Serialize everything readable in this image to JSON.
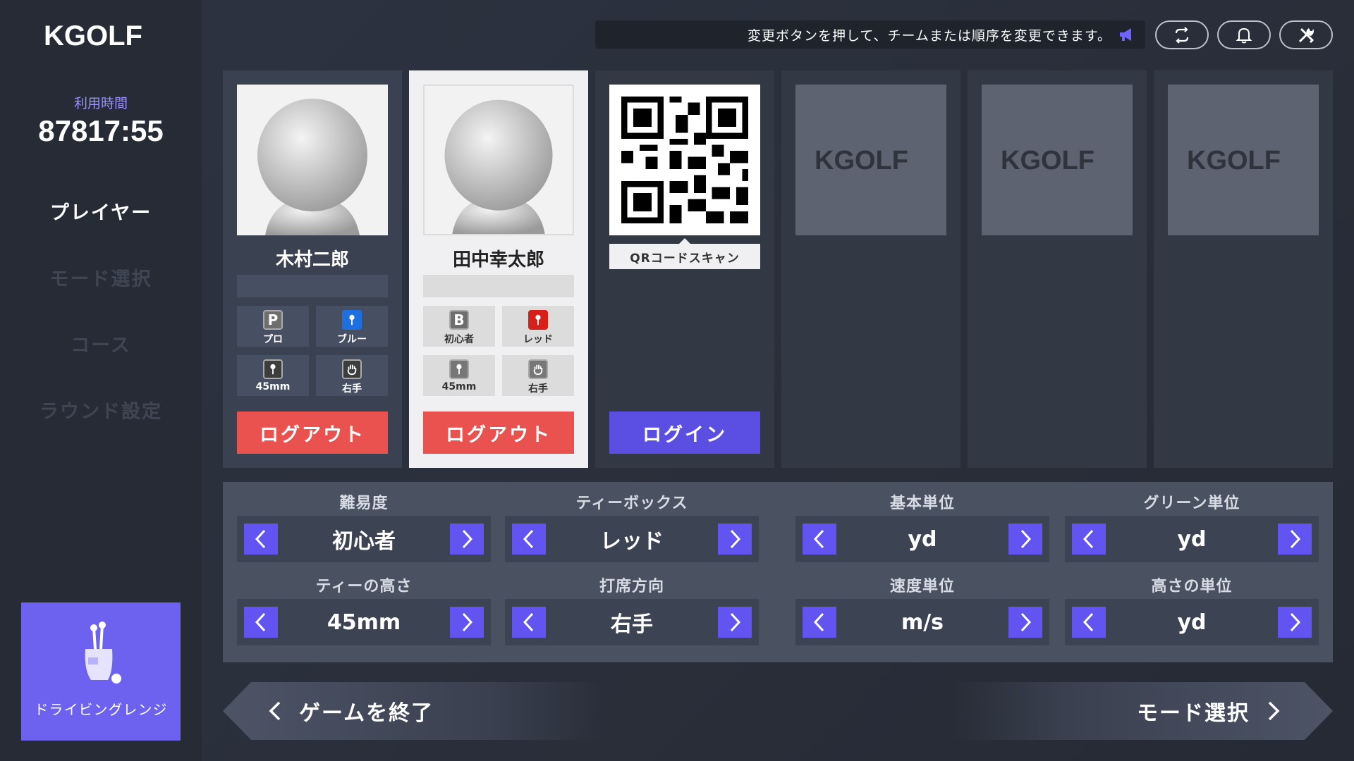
{
  "app": {
    "logo_text": "KGOLF"
  },
  "sidebar": {
    "usage_label": "利用時間",
    "usage_time": "87817:55",
    "nav": [
      {
        "label": "プレイヤー",
        "active": true
      },
      {
        "label": "モード選択",
        "active": false
      },
      {
        "label": "コース",
        "active": false
      },
      {
        "label": "ラウンド設定",
        "active": false
      }
    ],
    "range_label": "ドライビングレンジ"
  },
  "topbar": {
    "notice": "変更ボタンを押して、チームまたは順序を変更できます。",
    "buttons": [
      "swap-icon",
      "bell-icon",
      "tools-icon"
    ]
  },
  "players": [
    {
      "name": "木村二郎",
      "level_badge": "P",
      "level": "プロ",
      "tee_color": "ブルー",
      "tee_height": "45mm",
      "hand": "右手",
      "action": "ログアウト"
    },
    {
      "name": "田中幸太郎",
      "level_badge": "B",
      "level": "初心者",
      "tee_color": "レッド",
      "tee_height": "45mm",
      "hand": "右手",
      "action": "ログアウト"
    }
  ],
  "login_slot": {
    "qr_label": "QRコードスキャン",
    "action": "ログイン"
  },
  "empty_slots": [
    "KGOLF",
    "KGOLF",
    "KGOLF"
  ],
  "settings": [
    {
      "label": "難易度",
      "value": "初心者"
    },
    {
      "label": "ティーボックス",
      "value": "レッド"
    },
    {
      "label": "基本単位",
      "value": "yd"
    },
    {
      "label": "グリーン単位",
      "value": "yd"
    },
    {
      "label": "ティーの高さ",
      "value": "45mm"
    },
    {
      "label": "打席方向",
      "value": "右手"
    },
    {
      "label": "速度単位",
      "value": "m/s"
    },
    {
      "label": "高さの単位",
      "value": "yd"
    }
  ],
  "bottom": {
    "exit_label": "ゲームを終了",
    "next_label": "モード選択"
  },
  "colors": {
    "accent": "#6254f0",
    "logout": "#e9524f",
    "blue_tee": "#1e6fe0",
    "red_tee": "#d8201a"
  }
}
